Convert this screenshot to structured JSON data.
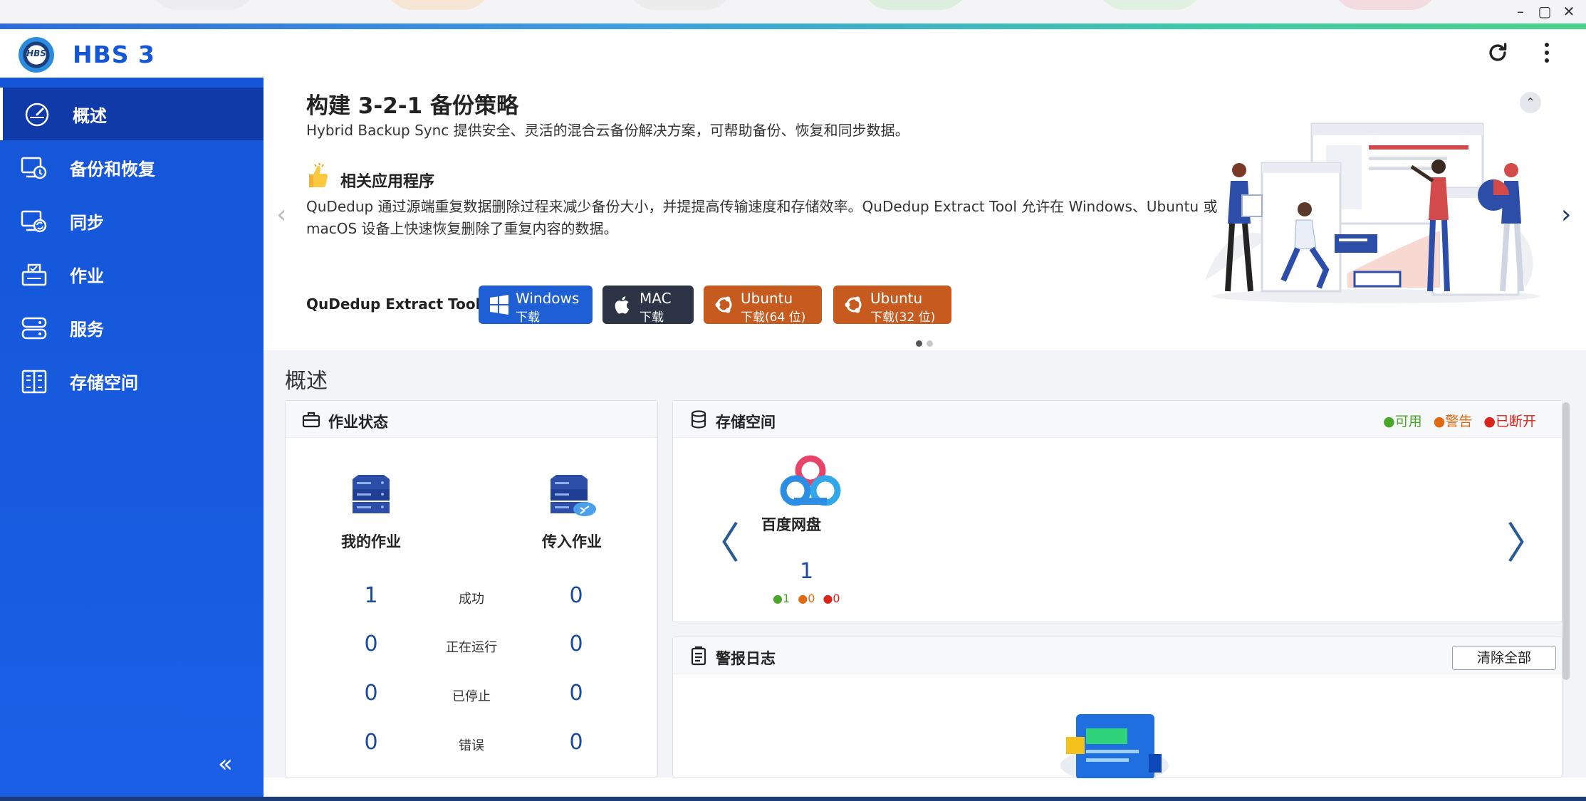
{
  "window": {
    "minimize_glyph": "–",
    "maximize_glyph": "▢",
    "close_glyph": "✕"
  },
  "app": {
    "logo_text": "HBS",
    "title": "HBS 3"
  },
  "sidebar": {
    "items": [
      {
        "label": "概述",
        "icon": "dashboard-gauge-icon",
        "active": true
      },
      {
        "label": "备份和恢复",
        "icon": "backup-restore-icon",
        "active": false
      },
      {
        "label": "同步",
        "icon": "sync-icon",
        "active": false
      },
      {
        "label": "作业",
        "icon": "jobs-icon",
        "active": false
      },
      {
        "label": "服务",
        "icon": "services-icon",
        "active": false
      },
      {
        "label": "存储空间",
        "icon": "storage-space-icon",
        "active": false
      }
    ],
    "collapse_glyph": "«"
  },
  "banner": {
    "title": "构建 3-2-1 备份策略",
    "subtitle": "Hybrid Backup Sync 提供安全、灵活的混合云备份解决方案，可帮助备份、恢复和同步数据。",
    "related_heading": "相关应用程序",
    "description": "QuDedup 通过源端重复数据删除过程来减少备份大小，并提提高传输速度和存储效率。QuDedup Extract Tool 允许在 Windows、Ubuntu 或 macOS 设备上快速恢复删除了重复内容的数据。",
    "tool_label": "QuDedup Extract Tool:",
    "downloads": [
      {
        "os": "Windows",
        "sub": "下载",
        "color": "#1f5fd6"
      },
      {
        "os": "MAC",
        "sub": "下载",
        "color": "#2c3446"
      },
      {
        "os": "Ubuntu",
        "sub": "下载(64 位)",
        "color": "#c75a1e"
      },
      {
        "os": "Ubuntu",
        "sub": "下载(32 位)",
        "color": "#c75a1e"
      }
    ],
    "prev_glyph": "‹",
    "next_glyph": "›",
    "collapse_glyph": "⌃"
  },
  "overview": {
    "title": "概述",
    "job_status": {
      "title": "作业状态",
      "columns": [
        "我的作业",
        "传入作业"
      ],
      "rows": [
        {
          "label": "成功",
          "mine": "1",
          "incoming": "0"
        },
        {
          "label": "正在运行",
          "mine": "0",
          "incoming": "0"
        },
        {
          "label": "已停止",
          "mine": "0",
          "incoming": "0"
        },
        {
          "label": "错误",
          "mine": "0",
          "incoming": "0"
        }
      ]
    },
    "storage": {
      "title": "存储空间",
      "legend": [
        {
          "label": "●可用",
          "color": "#4aa52a"
        },
        {
          "label": "●警告",
          "color": "#e06a12"
        },
        {
          "label": "●已断开",
          "color": "#d9241c"
        }
      ],
      "provider": "百度网盘",
      "count": "1",
      "available": "●1",
      "warning": "●0",
      "disconnected": "●0",
      "prev_glyph": "〈",
      "next_glyph": "〉"
    },
    "alerts": {
      "title": "警报日志",
      "clear_all": "清除全部"
    }
  }
}
